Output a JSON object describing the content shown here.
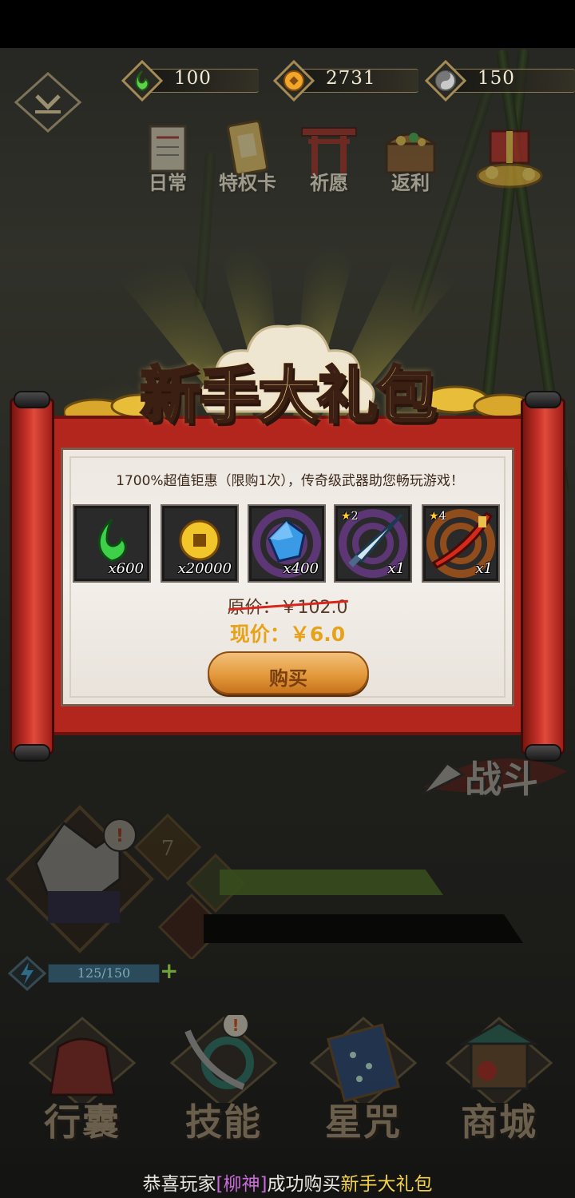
{
  "resources": [
    {
      "name": "jade-icon",
      "value": "100",
      "color": "#45c43c"
    },
    {
      "name": "coin-icon",
      "value": "2731",
      "color": "#f1a72c"
    },
    {
      "name": "spirit-icon",
      "value": "150",
      "color": "#a7a7a7"
    }
  ],
  "top_menu": [
    {
      "label": "日常",
      "icon": "scroll-icon"
    },
    {
      "label": "特权卡",
      "icon": "card-icon"
    },
    {
      "label": "祈愿",
      "icon": "shrine-icon"
    },
    {
      "label": "返利",
      "icon": "chest-icon"
    },
    {
      "label": "",
      "icon": "gift-icon"
    }
  ],
  "popup": {
    "title": "新手大礼包",
    "description": "1700%超值钜惠（限购1次），传奇级武器助您畅玩游戏！",
    "items": [
      {
        "icon": "jade-icon",
        "qty": "x600",
        "stars": ""
      },
      {
        "icon": "coin-icon",
        "qty": "x20000",
        "stars": ""
      },
      {
        "icon": "gem-icon",
        "qty": "x400",
        "stars": ""
      },
      {
        "icon": "sword-icon",
        "qty": "x1",
        "stars": "2"
      },
      {
        "icon": "blade-icon",
        "qty": "x1",
        "stars": "4"
      }
    ],
    "original_price": "原价：￥102.0",
    "current_price": "现价：￥6.0",
    "buy_label": "购买"
  },
  "battle_label": "战斗",
  "hero": {
    "level": "7"
  },
  "energy": {
    "text": "125/150",
    "fraction": 0.833
  },
  "bottom_nav": [
    {
      "label": "行囊",
      "icon": "bag-icon"
    },
    {
      "label": "技能",
      "icon": "skill-icon"
    },
    {
      "label": "星咒",
      "icon": "star-map-icon"
    },
    {
      "label": "商城",
      "icon": "shop-icon"
    }
  ],
  "ticker": {
    "prefix": "恭喜玩家",
    "player": "[柳神]",
    "middle": "成功购买",
    "item": "新手大礼包"
  }
}
